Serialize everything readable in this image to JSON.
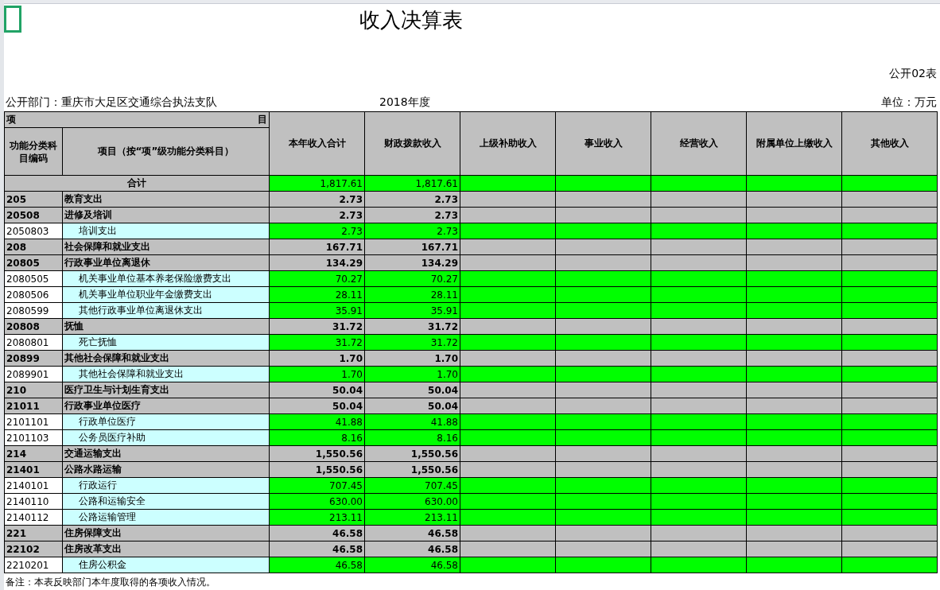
{
  "title": "收入决算表",
  "table_number": "公开02表",
  "department": "公开部门：重庆市大足区交通综合执法支队",
  "year": "2018年度",
  "unit": "单位：万元",
  "header": {
    "item_left": "项",
    "item_right": "目",
    "code_heading": "功能分类科目编码",
    "name_heading": "项目（按“项”级功能分类科目）",
    "columns": [
      "本年收入合计",
      "财政拨款收入",
      "上级补助收入",
      "事业收入",
      "经营收入",
      "附属单位上缴收入",
      "其他收入"
    ]
  },
  "total": {
    "label": "合计",
    "values": [
      "1,817.61",
      "1,817.61"
    ]
  },
  "rows": [
    {
      "kind": "group",
      "code": "205",
      "name": "教育支出",
      "values": [
        "2.73",
        "2.73"
      ]
    },
    {
      "kind": "group",
      "code": "20508",
      "name": "进修及培训",
      "values": [
        "2.73",
        "2.73"
      ]
    },
    {
      "kind": "item",
      "code": "2050803",
      "name": "培训支出",
      "values": [
        "2.73",
        "2.73"
      ]
    },
    {
      "kind": "group",
      "code": "208",
      "name": "社会保障和就业支出",
      "values": [
        "167.71",
        "167.71"
      ]
    },
    {
      "kind": "group",
      "code": "20805",
      "name": "行政事业单位离退休",
      "values": [
        "134.29",
        "134.29"
      ]
    },
    {
      "kind": "item",
      "code": "2080505",
      "name": "机关事业单位基本养老保险缴费支出",
      "values": [
        "70.27",
        "70.27"
      ]
    },
    {
      "kind": "item",
      "code": "2080506",
      "name": "机关事业单位职业年金缴费支出",
      "values": [
        "28.11",
        "28.11"
      ]
    },
    {
      "kind": "item",
      "code": "2080599",
      "name": "其他行政事业单位离退休支出",
      "values": [
        "35.91",
        "35.91"
      ]
    },
    {
      "kind": "group",
      "code": "20808",
      "name": "抚恤",
      "values": [
        "31.72",
        "31.72"
      ]
    },
    {
      "kind": "item",
      "code": "2080801",
      "name": "死亡抚恤",
      "values": [
        "31.72",
        "31.72"
      ]
    },
    {
      "kind": "group",
      "code": "20899",
      "name": "其他社会保障和就业支出",
      "values": [
        "1.70",
        "1.70"
      ]
    },
    {
      "kind": "item",
      "code": "2089901",
      "name": "其他社会保障和就业支出",
      "values": [
        "1.70",
        "1.70"
      ]
    },
    {
      "kind": "group",
      "code": "210",
      "name": "医疗卫生与计划生育支出",
      "values": [
        "50.04",
        "50.04"
      ]
    },
    {
      "kind": "group",
      "code": "21011",
      "name": "行政事业单位医疗",
      "values": [
        "50.04",
        "50.04"
      ]
    },
    {
      "kind": "item",
      "code": "2101101",
      "name": "行政单位医疗",
      "values": [
        "41.88",
        "41.88"
      ]
    },
    {
      "kind": "item",
      "code": "2101103",
      "name": "公务员医疗补助",
      "values": [
        "8.16",
        "8.16"
      ]
    },
    {
      "kind": "group",
      "code": "214",
      "name": "交通运输支出",
      "values": [
        "1,550.56",
        "1,550.56"
      ]
    },
    {
      "kind": "group",
      "code": "21401",
      "name": "公路水路运输",
      "values": [
        "1,550.56",
        "1,550.56"
      ]
    },
    {
      "kind": "item",
      "code": "2140101",
      "name": "行政运行",
      "values": [
        "707.45",
        "707.45"
      ]
    },
    {
      "kind": "item",
      "code": "2140110",
      "name": "公路和运输安全",
      "values": [
        "630.00",
        "630.00"
      ]
    },
    {
      "kind": "item",
      "code": "2140112",
      "name": "公路运输管理",
      "values": [
        "213.11",
        "213.11"
      ]
    },
    {
      "kind": "group",
      "code": "221",
      "name": "住房保障支出",
      "values": [
        "46.58",
        "46.58"
      ]
    },
    {
      "kind": "group",
      "code": "22102",
      "name": "住房改革支出",
      "values": [
        "46.58",
        "46.58"
      ]
    },
    {
      "kind": "item",
      "code": "2210201",
      "name": "住房公积金",
      "values": [
        "46.58",
        "46.58"
      ]
    }
  ],
  "note": "备注：本表反映部门本年度取得的各项收入情况。"
}
